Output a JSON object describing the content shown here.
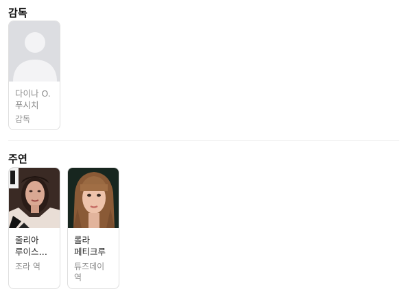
{
  "sections": {
    "director": {
      "title": "감독",
      "people": [
        {
          "name": "다이나 O. 푸시치",
          "role": "감독",
          "photo": "placeholder-avatar"
        }
      ]
    },
    "cast": {
      "title": "주연",
      "people": [
        {
          "name": "줄리아 루이스 드...",
          "role": "조라 역",
          "photo": "portrait-dark-hair-woman"
        },
        {
          "name": "롤라 페티크루",
          "role": "튜즈데이 역",
          "photo": "portrait-bangs-woman"
        }
      ]
    }
  },
  "colors": {
    "placeholder_bg": "#dcdde1",
    "placeholder_silhouette": "#f3f3f5",
    "card_border": "#dedede",
    "muted_text": "#8f8f8f"
  }
}
